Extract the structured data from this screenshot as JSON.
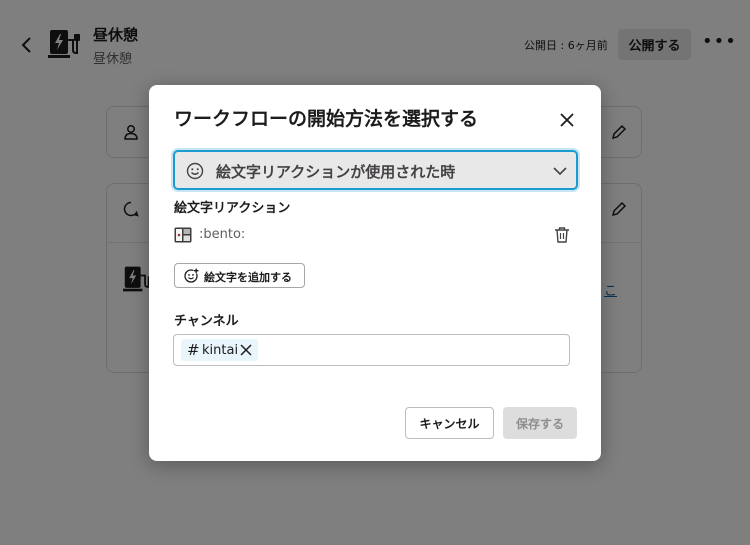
{
  "app": {
    "workflow_title": "昼休憩",
    "workflow_subtitle": "昼休憩",
    "published_text": "公開日 : 6ヶ月前",
    "publish_label": "公開する",
    "more_label": "•••",
    "edit_link_text": "こ"
  },
  "modal": {
    "title": "ワークフローの開始方法を選択する",
    "trigger_select_value": "絵文字リアクションが使用された時",
    "emoji_section_label": "絵文字リアクション",
    "emoji_name": ":bento:",
    "add_emoji_label": "絵文字を追加する",
    "channel_section_label": "チャンネル",
    "channel_chip_hash": "#",
    "channel_chip_name": "kintai",
    "cancel_label": "キャンセル",
    "save_label": "保存する"
  },
  "icons": {
    "back": "chevron-left-icon",
    "workflow": "ev-charger-icon",
    "close": "close-icon",
    "smile": "smile-icon",
    "chevron_down": "chevron-down-icon",
    "bento": "bento-emoji-icon",
    "trash": "trash-icon",
    "add_emoji": "add-emoji-icon",
    "remove": "remove-chip-icon"
  },
  "colors": {
    "focus_ring": "#1d9bd1",
    "chip_bg": "#e8f5fa",
    "link": "#1264a3"
  }
}
